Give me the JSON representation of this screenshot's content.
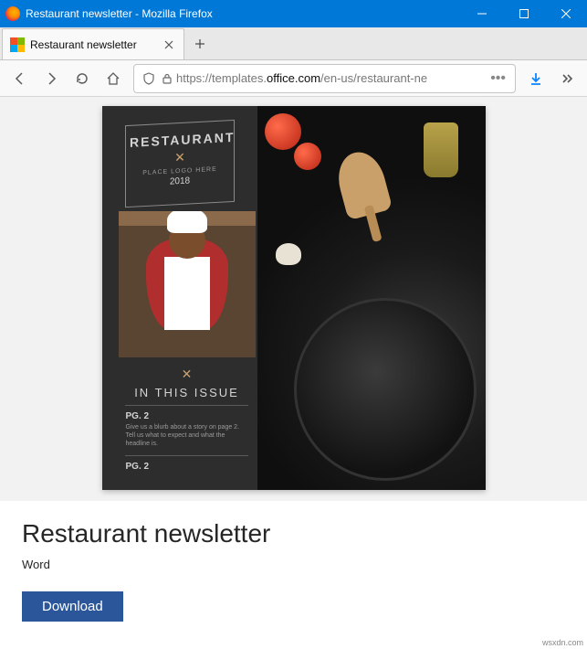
{
  "window": {
    "title": "Restaurant newsletter - Mozilla Firefox"
  },
  "tab": {
    "label": "Restaurant newsletter"
  },
  "url": {
    "protocol": "https://",
    "prefix": "templates.",
    "host": "office.com",
    "path": "/en-us/restaurant-ne"
  },
  "preview": {
    "badge_name": "RESTAURANT",
    "badge_sub": "PLACE LOGO HERE",
    "badge_year": "2018",
    "issue_head": "IN THIS ISSUE",
    "pg_label": "PG. 2",
    "blurb": "Give us a blurb about a story on page 2. Tell us what to expect and what the headline is."
  },
  "details": {
    "title": "Restaurant newsletter",
    "app": "Word",
    "download": "Download"
  },
  "watermark": "wsxdn.com"
}
